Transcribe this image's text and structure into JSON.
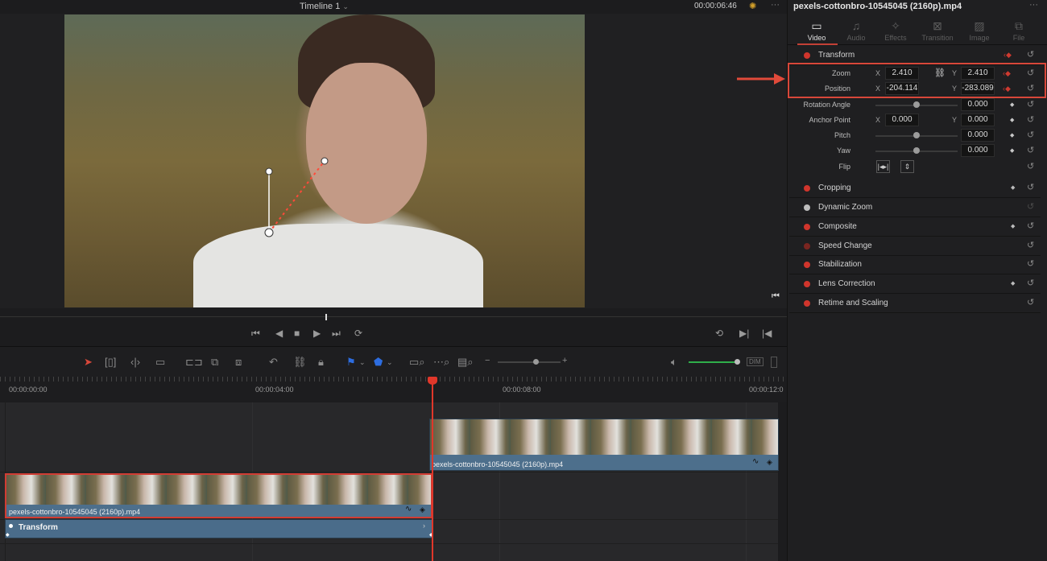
{
  "viewer": {
    "timeline_title": "Timeline 1",
    "timecode": "00:00:06:46"
  },
  "inspector": {
    "clip_title": "pexels-cottonbro-10545045 (2160p).mp4",
    "tabs": [
      {
        "label": "Video",
        "icon": "video-icon"
      },
      {
        "label": "Audio",
        "icon": "audio-icon"
      },
      {
        "label": "Effects",
        "icon": "effects-icon"
      },
      {
        "label": "Transition",
        "icon": "transition-icon"
      },
      {
        "label": "Image",
        "icon": "image-icon"
      },
      {
        "label": "File",
        "icon": "file-icon"
      }
    ],
    "transform": {
      "title": "Transform",
      "zoom": {
        "label": "Zoom",
        "x_axis": "X",
        "x": "2.410",
        "y_axis": "Y",
        "y": "2.410"
      },
      "position": {
        "label": "Position",
        "x_axis": "X",
        "x": "-204.114",
        "y_axis": "Y",
        "y": "-283.089"
      },
      "rotation": {
        "label": "Rotation Angle",
        "value": "0.000"
      },
      "anchor": {
        "label": "Anchor Point",
        "x_axis": "X",
        "x": "0.000",
        "y_axis": "Y",
        "y": "0.000"
      },
      "pitch": {
        "label": "Pitch",
        "value": "0.000"
      },
      "yaw": {
        "label": "Yaw",
        "value": "0.000"
      },
      "flip": {
        "label": "Flip"
      }
    },
    "sections": [
      "Cropping",
      "Dynamic Zoom",
      "Composite",
      "Speed Change",
      "Stabilization",
      "Lens Correction",
      "Retime and Scaling"
    ]
  },
  "timeline": {
    "ruler": [
      "00:00:00:00",
      "00:00:04:00",
      "00:00:08:00",
      "00:00:12:0"
    ],
    "clip_upper": "pexels-cottonbro-10545045 (2160p).mp4",
    "clip_lower": "pexels-cottonbro-10545045 (2160p).mp4",
    "keyframe_track": "Transform"
  },
  "colors": {
    "accent": "#d8473a",
    "clip": "#4d6f8c"
  }
}
